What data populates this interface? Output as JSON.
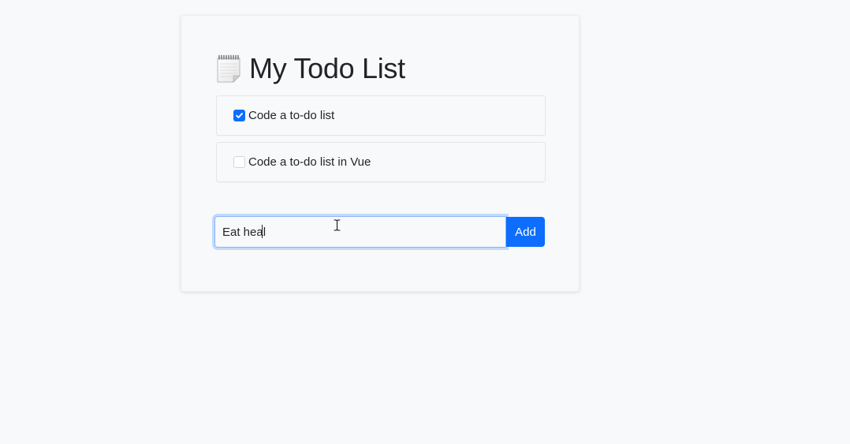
{
  "header": {
    "title": "My Todo List",
    "icon": "notepad-icon"
  },
  "todos": [
    {
      "label": "Code a to-do list",
      "checked": true
    },
    {
      "label": "Code a to-do list in Vue",
      "checked": false
    }
  ],
  "new_todo": {
    "value": "Eat heal",
    "button_label": "Add"
  },
  "colors": {
    "accent": "#0d6efd",
    "background": "#f8f9fb",
    "text": "#212529"
  }
}
